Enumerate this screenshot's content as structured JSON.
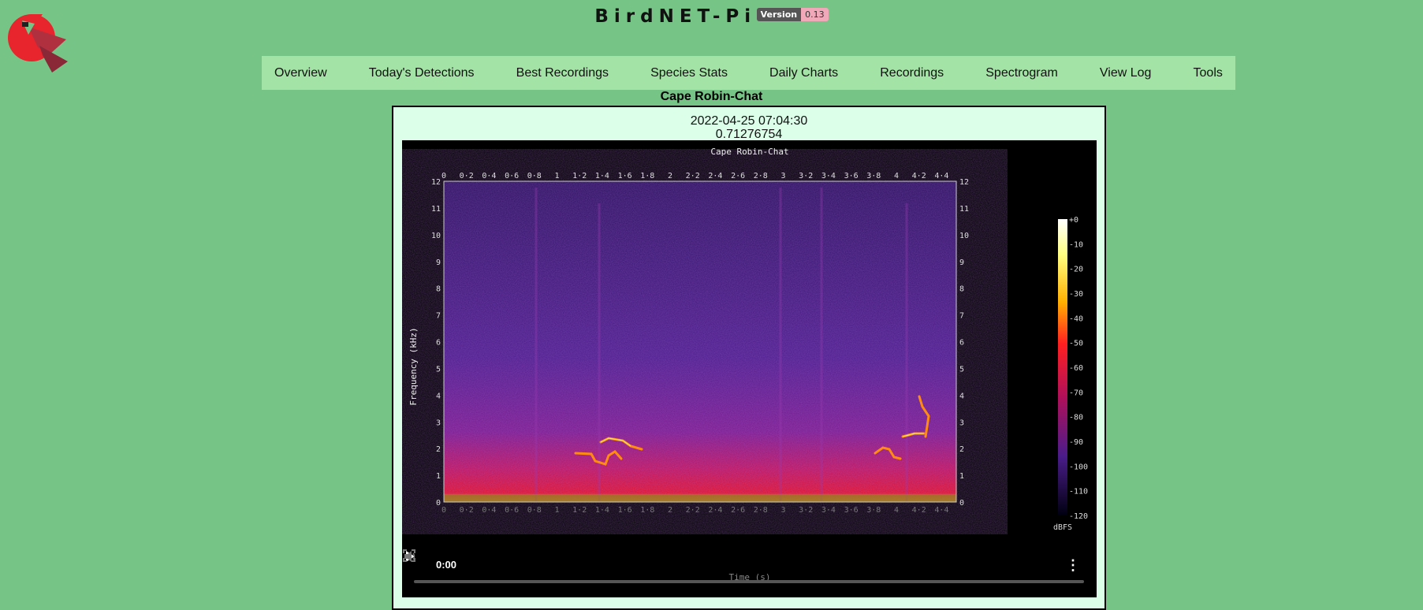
{
  "header": {
    "site_name": "BirdNET-Pi",
    "version_label": "Version",
    "version_value": "0.13"
  },
  "nav": {
    "items": [
      "Overview",
      "Today's Detections",
      "Best Recordings",
      "Species Stats",
      "Daily Charts",
      "Recordings",
      "Spectrogram",
      "View Log",
      "Tools"
    ]
  },
  "detection": {
    "species": "Cape Robin-Chat",
    "datetime": "2022-04-25 07:04:30",
    "confidence": "0.71276754"
  },
  "spectrogram": {
    "title": "Cape Robin-Chat",
    "ylabel": "Frequency (kHz)",
    "xlabel": "Time (s)",
    "colorbar_label": "dBFS",
    "y_ticks": [
      "0",
      "1",
      "2",
      "3",
      "4",
      "5",
      "6",
      "7",
      "8",
      "9",
      "10",
      "11",
      "12"
    ],
    "x_ticks": [
      "0",
      "0·2",
      "0·4",
      "0·6",
      "0·8",
      "1",
      "1·2",
      "1·4",
      "1·6",
      "1·8",
      "2",
      "2·2",
      "2·4",
      "2·6",
      "2·8",
      "3",
      "3·2",
      "3·4",
      "3·6",
      "3·8",
      "4",
      "4·2",
      "4·4"
    ],
    "colorbar_ticks": [
      "+0",
      "-10",
      "-20",
      "-30",
      "-40",
      "-50",
      "-60",
      "-70",
      "-80",
      "-90",
      "-100",
      "-110",
      "-120"
    ]
  },
  "player": {
    "current_time": "0:00"
  },
  "colors": {
    "page_bg": "#77c487",
    "nav_bg": "#a3e3a5",
    "card_bg": "#dcffe9",
    "spectrogram_bg": "#3a1a78",
    "call_color": "#ff7a00"
  }
}
